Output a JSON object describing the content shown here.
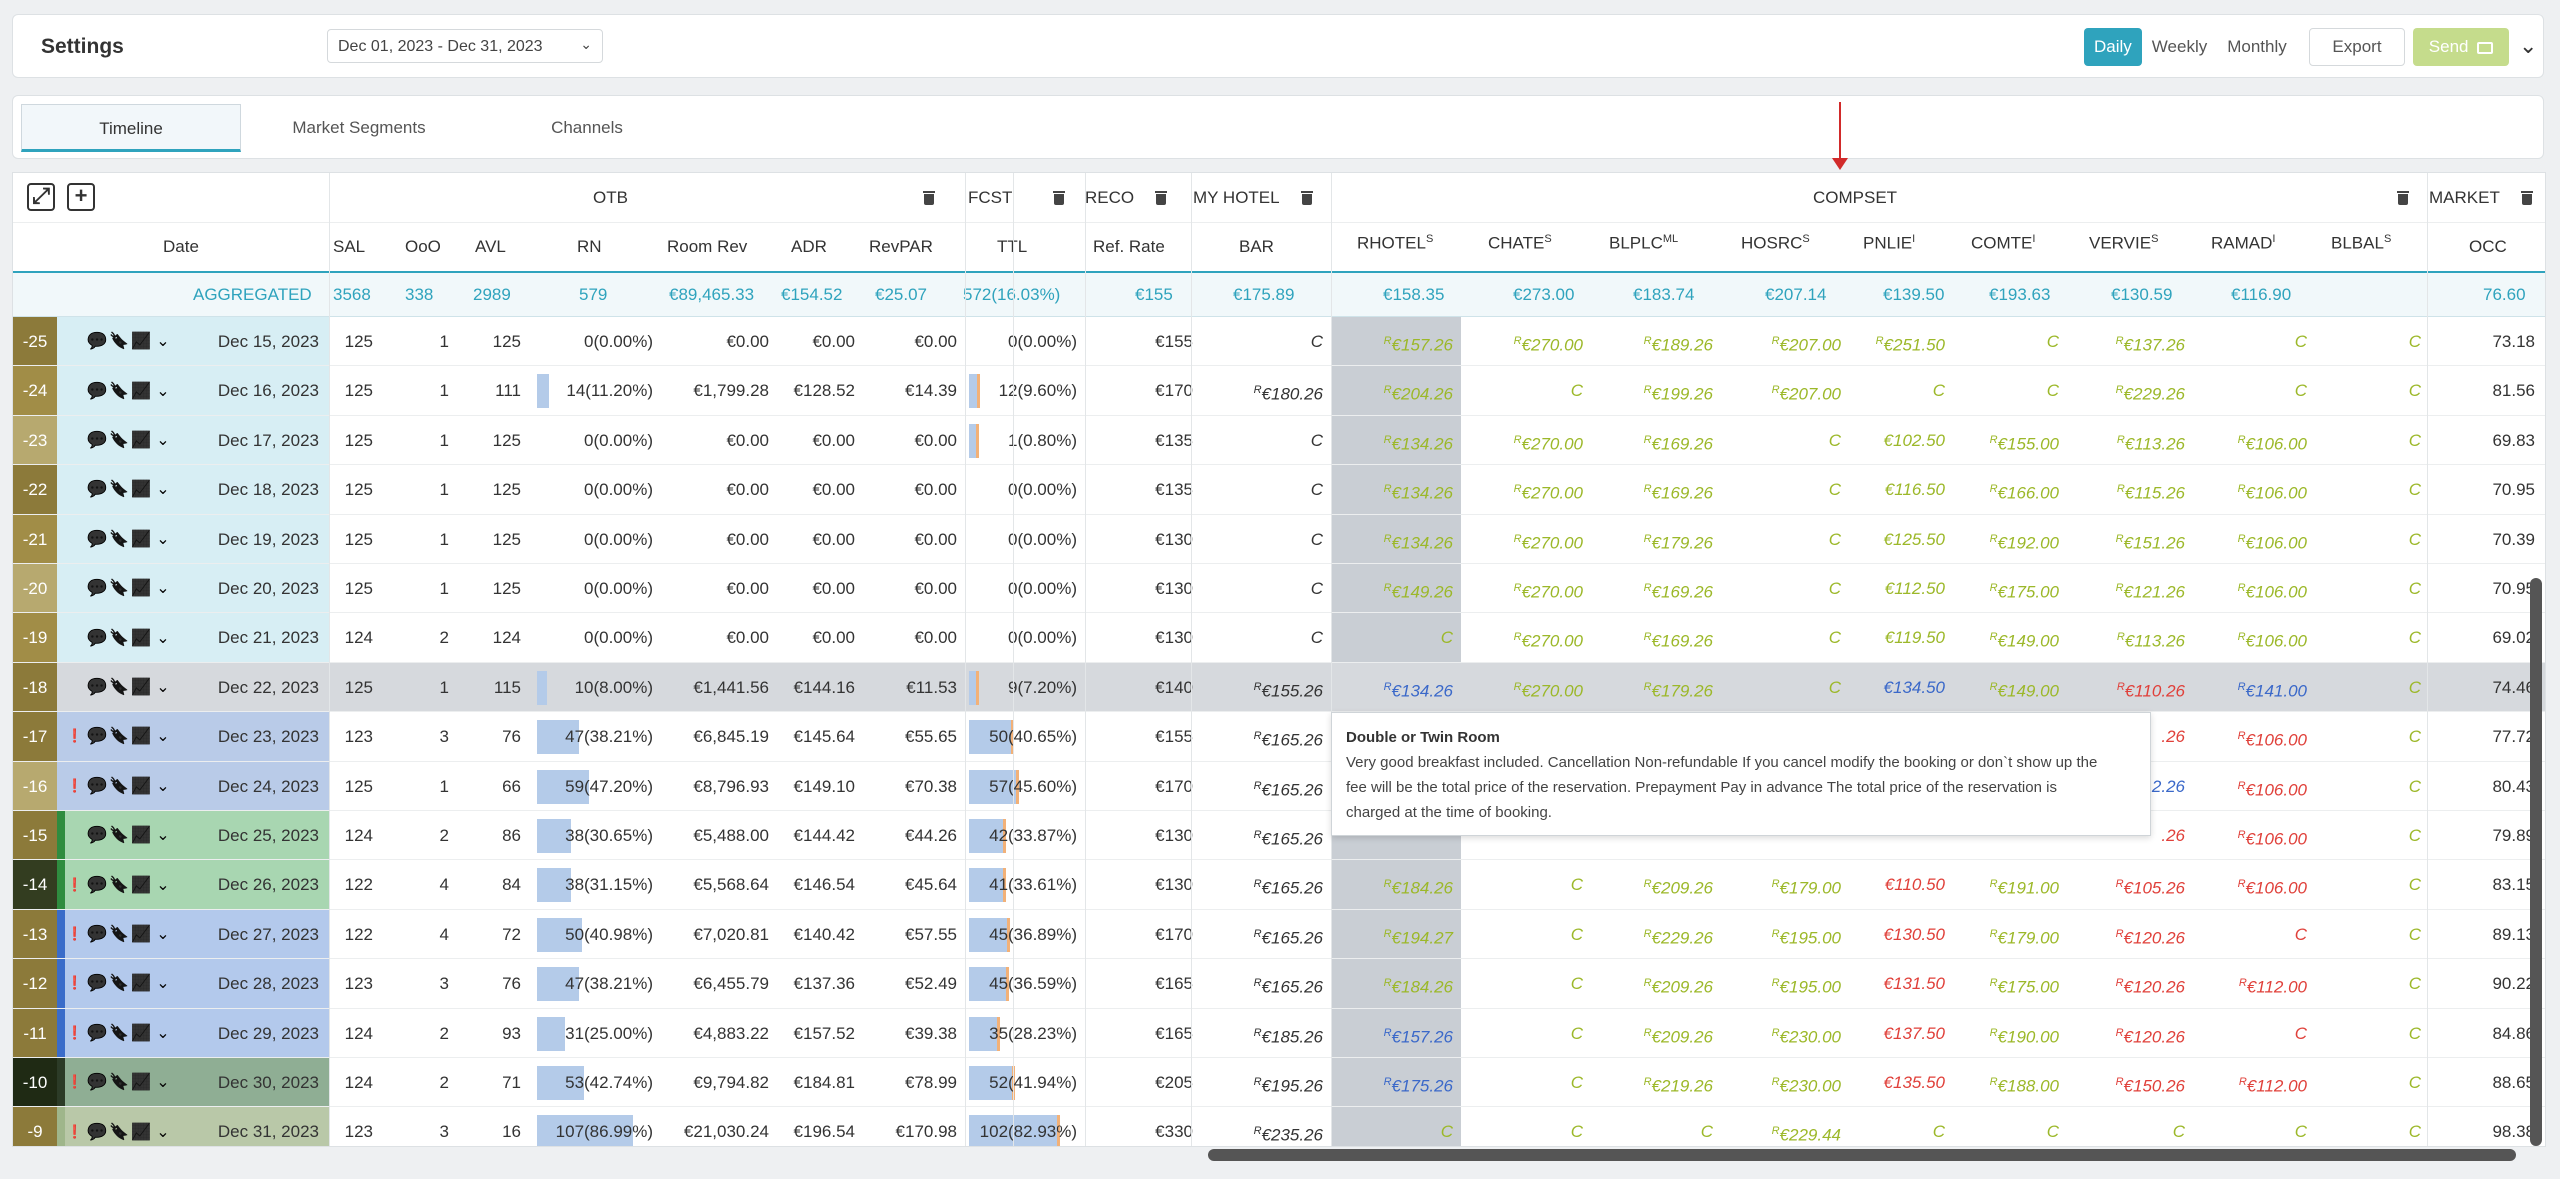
{
  "header": {
    "title": "Settings",
    "date_range": "Dec 01, 2023 - Dec 31, 2023",
    "views": [
      "Daily",
      "Weekly",
      "Monthly"
    ],
    "active_view": "Daily",
    "export_label": "Export",
    "send_label": "Send"
  },
  "tabs": [
    {
      "label": "Timeline",
      "active": true
    },
    {
      "label": "Market Segments",
      "active": false
    },
    {
      "label": "Channels",
      "active": false
    }
  ],
  "groups": {
    "otb": "OTB",
    "fcst": "FCST",
    "reco": "RECO",
    "my_hotel": "MY HOTEL",
    "compset": "COMPSET",
    "market": "MARKET"
  },
  "columns": {
    "date": "Date",
    "sal": "SAL",
    "ooo": "OoO",
    "avl": "AVL",
    "rn": "RN",
    "room_rev": "Room Rev",
    "adr": "ADR",
    "revpar": "RevPAR",
    "ttl": "TTL",
    "ref_rate": "Ref. Rate",
    "bar": "BAR",
    "rhotel": "RHOTEL",
    "rhotel_sup": "S",
    "chate": "CHATE",
    "chate_sup": "S",
    "blplc": "BLPLC",
    "blplc_sup": "ML",
    "hosrc": "HOSRC",
    "hosrc_sup": "S",
    "pnlie": "PNLIE",
    "pnlie_sup": "I",
    "comte": "COMTE",
    "comte_sup": "I",
    "vervie": "VERVIE",
    "vervie_sup": "S",
    "ramad": "RAMAD",
    "ramad_sup": "I",
    "blbal": "BLBAL",
    "blbal_sup": "S",
    "occ": "OCC"
  },
  "aggregated": {
    "label": "AGGREGATED",
    "sal": "3568",
    "ooo": "338",
    "avl": "2989",
    "rn": "579",
    "room_rev": "€89,465.33",
    "adr": "€154.52",
    "revpar": "€25.07",
    "ttl": "572(16.03%)",
    "ref_rate": "€155",
    "bar": "€175.89",
    "rhotel": "€158.35",
    "chate": "€273.00",
    "blplc": "€183.74",
    "hosrc": "€207.14",
    "pnlie": "€139.50",
    "comte": "€193.63",
    "vervie": "€130.59",
    "ramad": "€116.90",
    "blbal": "",
    "occ": "76.60"
  },
  "rows": [
    {
      "d": "-25",
      "date": "Dec 15, 2023",
      "sal": "125",
      "ooo": "1",
      "avl": "125",
      "rn": "0(0.00%)",
      "rnp": 0,
      "rev": "€0.00",
      "adr": "€0.00",
      "revpar": "€0.00",
      "ttl": "0(0.00%)",
      "ttlp": 0,
      "ref": "€155",
      "bar": "C",
      "rh": "R€157.26",
      "ch": "R€270.00",
      "bl": "R€189.26",
      "ho": "R€207.00",
      "pn": "R€251.50",
      "co": "C",
      "ve": "R€137.26",
      "ra": "C",
      "bb": "C",
      "occ": "73.18",
      "excl": false
    },
    {
      "d": "-24",
      "date": "Dec 16, 2023",
      "sal": "125",
      "ooo": "1",
      "avl": "111",
      "rn": "14(11.20%)",
      "rnp": 11.2,
      "rev": "€1,799.28",
      "adr": "€128.52",
      "revpar": "€14.39",
      "ttl": "12(9.60%)",
      "ttlp": 9.6,
      "ref": "€170",
      "bar": "R€180.26",
      "rh": "R€204.26",
      "ch": "C",
      "bl": "R€199.26",
      "ho": "R€207.00",
      "pn": "C",
      "co": "C",
      "ve": "R€229.26",
      "ra": "C",
      "bb": "C",
      "occ": "81.56",
      "excl": false
    },
    {
      "d": "-23",
      "date": "Dec 17, 2023",
      "sal": "125",
      "ooo": "1",
      "avl": "125",
      "rn": "0(0.00%)",
      "rnp": 0,
      "rev": "€0.00",
      "adr": "€0.00",
      "revpar": "€0.00",
      "ttl": "1(0.80%)",
      "ttlp": 0.8,
      "ref": "€135",
      "bar": "C",
      "rh": "R€134.26",
      "ch": "R€270.00",
      "bl": "R€169.26",
      "ho": "C",
      "pn": "€102.50",
      "co": "R€155.00",
      "ve": "R€113.26",
      "ra": "R€106.00",
      "bb": "C",
      "occ": "69.83",
      "excl": false
    },
    {
      "d": "-22",
      "date": "Dec 18, 2023",
      "sal": "125",
      "ooo": "1",
      "avl": "125",
      "rn": "0(0.00%)",
      "rnp": 0,
      "rev": "€0.00",
      "adr": "€0.00",
      "revpar": "€0.00",
      "ttl": "0(0.00%)",
      "ttlp": 0,
      "ref": "€135",
      "bar": "C",
      "rh": "R€134.26",
      "ch": "R€270.00",
      "bl": "R€169.26",
      "ho": "C",
      "pn": "€116.50",
      "co": "R€166.00",
      "ve": "R€115.26",
      "ra": "R€106.00",
      "bb": "C",
      "occ": "70.95",
      "excl": false
    },
    {
      "d": "-21",
      "date": "Dec 19, 2023",
      "sal": "125",
      "ooo": "1",
      "avl": "125",
      "rn": "0(0.00%)",
      "rnp": 0,
      "rev": "€0.00",
      "adr": "€0.00",
      "revpar": "€0.00",
      "ttl": "0(0.00%)",
      "ttlp": 0,
      "ref": "€130",
      "bar": "C",
      "rh": "R€134.26",
      "ch": "R€270.00",
      "bl": "R€179.26",
      "ho": "C",
      "pn": "€125.50",
      "co": "R€192.00",
      "ve": "R€151.26",
      "ra": "R€106.00",
      "bb": "C",
      "occ": "70.39",
      "excl": false
    },
    {
      "d": "-20",
      "date": "Dec 20, 2023",
      "sal": "125",
      "ooo": "1",
      "avl": "125",
      "rn": "0(0.00%)",
      "rnp": 0,
      "rev": "€0.00",
      "adr": "€0.00",
      "revpar": "€0.00",
      "ttl": "0(0.00%)",
      "ttlp": 0,
      "ref": "€130",
      "bar": "C",
      "rh": "R€149.26",
      "ch": "R€270.00",
      "bl": "R€169.26",
      "ho": "C",
      "pn": "€112.50",
      "co": "R€175.00",
      "ve": "R€121.26",
      "ra": "R€106.00",
      "bb": "C",
      "occ": "70.95",
      "excl": false
    },
    {
      "d": "-19",
      "date": "Dec 21, 2023",
      "sal": "124",
      "ooo": "2",
      "avl": "124",
      "rn": "0(0.00%)",
      "rnp": 0,
      "rev": "€0.00",
      "adr": "€0.00",
      "revpar": "€0.00",
      "ttl": "0(0.00%)",
      "ttlp": 0,
      "ref": "€130",
      "bar": "C",
      "rh": "C",
      "ch": "R€270.00",
      "bl": "R€169.26",
      "ho": "C",
      "pn": "€119.50",
      "co": "R€149.00",
      "ve": "R€113.26",
      "ra": "R€106.00",
      "bb": "C",
      "occ": "69.02",
      "excl": false
    },
    {
      "d": "-18",
      "date": "Dec 22, 2023",
      "sal": "125",
      "ooo": "1",
      "avl": "115",
      "rn": "10(8.00%)",
      "rnp": 8,
      "rev": "€1,441.56",
      "adr": "€144.16",
      "revpar": "€11.53",
      "ttl": "9(7.20%)",
      "ttlp": 7.2,
      "ref": "€140",
      "bar": "R€155.26",
      "rh": "R€134.26",
      "ch": "R€270.00",
      "bl": "R€179.26",
      "ho": "C",
      "pn": "€134.50",
      "co": "R€149.00",
      "ve": "R€110.26",
      "ra": "R€141.00",
      "bb": "C",
      "occ": "74.46",
      "excl": false
    },
    {
      "d": "-17",
      "date": "Dec 23, 2023",
      "sal": "123",
      "ooo": "3",
      "avl": "76",
      "rn": "47(38.21%)",
      "rnp": 38.21,
      "rev": "€6,845.19",
      "adr": "€145.64",
      "revpar": "€55.65",
      "ttl": "50(40.65%)",
      "ttlp": 40.65,
      "ref": "€155",
      "bar": "R€165.26",
      "rh": "",
      "ch": "",
      "bl": "",
      "ho": "",
      "pn": "",
      "co": "",
      "ve": ".26",
      "ra": "R€106.00",
      "bb": "C",
      "occ": "77.72",
      "excl": true
    },
    {
      "d": "-16",
      "date": "Dec 24, 2023",
      "sal": "125",
      "ooo": "1",
      "avl": "66",
      "rn": "59(47.20%)",
      "rnp": 47.2,
      "rev": "€8,796.93",
      "adr": "€149.10",
      "revpar": "€70.38",
      "ttl": "57(45.60%)",
      "ttlp": 45.6,
      "ref": "€170",
      "bar": "R€165.26",
      "rh": "",
      "ch": "",
      "bl": "",
      "ho": "",
      "pn": "",
      "co": "",
      "ve": "2.26",
      "ra": "R€106.00",
      "bb": "C",
      "occ": "80.43",
      "excl": true
    },
    {
      "d": "-15",
      "date": "Dec 25, 2023",
      "sal": "124",
      "ooo": "2",
      "avl": "86",
      "rn": "38(30.65%)",
      "rnp": 30.65,
      "rev": "€5,488.00",
      "adr": "€144.42",
      "revpar": "€44.26",
      "ttl": "42(33.87%)",
      "ttlp": 33.87,
      "ref": "€130",
      "bar": "R€165.26",
      "rh": "",
      "ch": "",
      "bl": "",
      "ho": "",
      "pn": "",
      "co": "",
      "ve": ".26",
      "ra": "R€106.00",
      "bb": "C",
      "occ": "79.89",
      "excl": false
    },
    {
      "d": "-14",
      "date": "Dec 26, 2023",
      "sal": "122",
      "ooo": "4",
      "avl": "84",
      "rn": "38(31.15%)",
      "rnp": 31.15,
      "rev": "€5,568.64",
      "adr": "€146.54",
      "revpar": "€45.64",
      "ttl": "41(33.61%)",
      "ttlp": 33.61,
      "ref": "€130",
      "bar": "R€165.26",
      "rh": "R€184.26",
      "ch": "C",
      "bl": "R€209.26",
      "ho": "R€179.00",
      "pn": "€110.50",
      "co": "R€191.00",
      "ve": "R€105.26",
      "ra": "R€106.00",
      "bb": "C",
      "occ": "83.15",
      "excl": true
    },
    {
      "d": "-13",
      "date": "Dec 27, 2023",
      "sal": "122",
      "ooo": "4",
      "avl": "72",
      "rn": "50(40.98%)",
      "rnp": 40.98,
      "rev": "€7,020.81",
      "adr": "€140.42",
      "revpar": "€57.55",
      "ttl": "45(36.89%)",
      "ttlp": 36.89,
      "ref": "€170",
      "bar": "R€165.26",
      "rh": "R€194.27",
      "ch": "C",
      "bl": "R€229.26",
      "ho": "R€195.00",
      "pn": "€130.50",
      "co": "R€179.00",
      "ve": "R€120.26",
      "ra": "C",
      "bb": "C",
      "occ": "89.13",
      "excl": true
    },
    {
      "d": "-12",
      "date": "Dec 28, 2023",
      "sal": "123",
      "ooo": "3",
      "avl": "76",
      "rn": "47(38.21%)",
      "rnp": 38.21,
      "rev": "€6,455.79",
      "adr": "€137.36",
      "revpar": "€52.49",
      "ttl": "45(36.59%)",
      "ttlp": 36.59,
      "ref": "€165",
      "bar": "R€165.26",
      "rh": "R€184.26",
      "ch": "C",
      "bl": "R€209.26",
      "ho": "R€195.00",
      "pn": "€131.50",
      "co": "R€175.00",
      "ve": "R€120.26",
      "ra": "R€112.00",
      "bb": "C",
      "occ": "90.22",
      "excl": true
    },
    {
      "d": "-11",
      "date": "Dec 29, 2023",
      "sal": "124",
      "ooo": "2",
      "avl": "93",
      "rn": "31(25.00%)",
      "rnp": 25,
      "rev": "€4,883.22",
      "adr": "€157.52",
      "revpar": "€39.38",
      "ttl": "35(28.23%)",
      "ttlp": 28.23,
      "ref": "€165",
      "bar": "R€185.26",
      "rh": "R€157.26",
      "ch": "C",
      "bl": "R€209.26",
      "ho": "R€230.00",
      "pn": "€137.50",
      "co": "R€190.00",
      "ve": "R€120.26",
      "ra": "C",
      "bb": "C",
      "occ": "84.86",
      "excl": true
    },
    {
      "d": "-10",
      "date": "Dec 30, 2023",
      "sal": "124",
      "ooo": "2",
      "avl": "71",
      "rn": "53(42.74%)",
      "rnp": 42.74,
      "rev": "€9,794.82",
      "adr": "€184.81",
      "revpar": "€78.99",
      "ttl": "52(41.94%)",
      "ttlp": 41.94,
      "ref": "€205",
      "bar": "R€195.26",
      "rh": "R€175.26",
      "ch": "C",
      "bl": "R€219.26",
      "ho": "R€230.00",
      "pn": "€135.50",
      "co": "R€188.00",
      "ve": "R€150.26",
      "ra": "R€112.00",
      "bb": "C",
      "occ": "88.65",
      "excl": true
    },
    {
      "d": "-9",
      "date": "Dec 31, 2023",
      "sal": "123",
      "ooo": "3",
      "avl": "16",
      "rn": "107(86.99%)",
      "rnp": 86.99,
      "rev": "€21,030.24",
      "adr": "€196.54",
      "revpar": "€170.98",
      "ttl": "102(82.93%)",
      "ttlp": 82.93,
      "ref": "€330",
      "bar": "R€235.26",
      "rh": "C",
      "ch": "C",
      "bl": "C",
      "ho": "R€229.44",
      "pn": "C",
      "co": "C",
      "ve": "C",
      "ra": "C",
      "bb": "C",
      "occ": "98.38",
      "excl": true
    }
  ],
  "tooltip": {
    "title": "Double or Twin Room",
    "line1": "Very good breakfast included. Cancellation Non-refundable If you cancel modify the booking or don`t show up the",
    "line2": "fee will be the total price of the reservation. Prepayment Pay in advance The total price of the reservation is",
    "line3": "charged at the time of booking."
  },
  "colors": {
    "accent": "#2fa3bd",
    "green_rate": "#9cb829",
    "red_rate": "#e0403a",
    "blue_rate": "#3a68c9",
    "highlight_row": "#d6d9dd",
    "rhotel_band": "#c9ced4"
  },
  "icons": [
    "expand-icon",
    "plus-icon",
    "trash-icon",
    "comment-icon",
    "bookmark-icon",
    "chart-icon",
    "chevron-down-icon",
    "alert-icon",
    "monitor-icon"
  ]
}
